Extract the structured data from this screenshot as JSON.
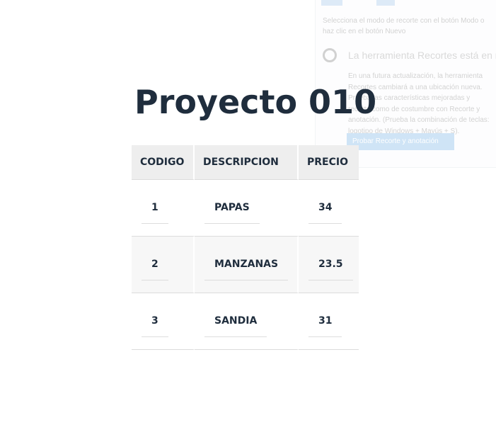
{
  "page": {
    "title": "Proyecto 010"
  },
  "table": {
    "headers": [
      "CODIGO",
      "DESCRIPCION",
      "PRECIO"
    ],
    "rows": [
      {
        "codigo": "1",
        "descripcion": "PAPAS",
        "precio": "34"
      },
      {
        "codigo": "2",
        "descripcion": "MANZANAS",
        "precio": "23.5"
      },
      {
        "codigo": "3",
        "descripcion": "SANDIA",
        "precio": "31"
      }
    ]
  },
  "background_window": {
    "description": "Selecciona el modo de recorte con el botón Modo o haz clic en el botón Nuevo",
    "title": "La herramienta Recortes está en movimiento...",
    "body": "En una futura actualización, la herramienta Recortes cambiará a una ubicación nueva. Prueba las características mejoradas y recorta como de costumbre con Recorte y anotación. (Prueba la combinación de teclas: logotipo de Windows + Mayús + S).",
    "button_label": "Probar Recorte y anotación"
  },
  "colors": {
    "text": "#1f2d3d",
    "header_bg": "#eeeeee",
    "row_alt_bg": "#f7f7f7",
    "accent": "#2b88d8"
  }
}
